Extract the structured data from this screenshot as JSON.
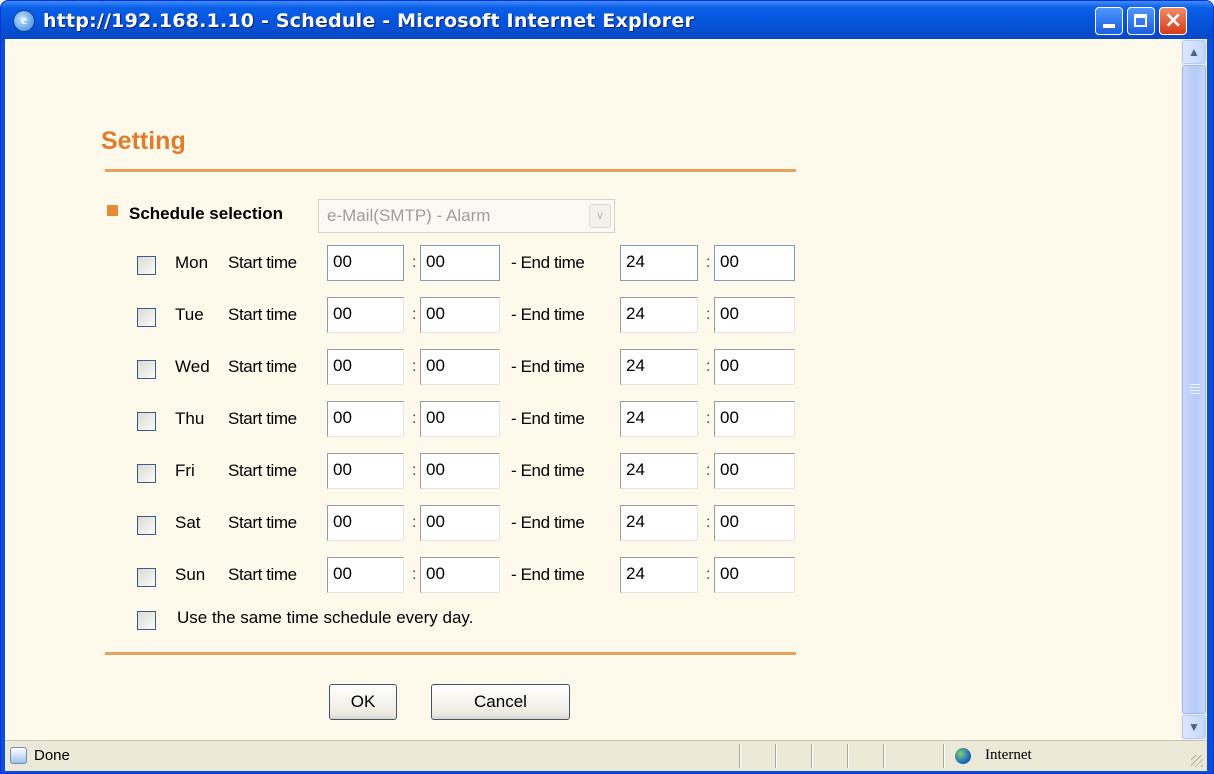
{
  "window": {
    "title": "http://192.168.1.10 - Schedule - Microsoft Internet Explorer"
  },
  "page": {
    "heading": "Setting",
    "schedule_selection_label": "Schedule selection",
    "schedule_selection_value": "e-Mail(SMTP) - Alarm",
    "start_label": "Start time",
    "end_label": "- End time",
    "colon": ":",
    "days": [
      {
        "day": "Mon",
        "start_h": "00",
        "start_m": "00",
        "end_h": "24",
        "end_m": "00"
      },
      {
        "day": "Tue",
        "start_h": "00",
        "start_m": "00",
        "end_h": "24",
        "end_m": "00"
      },
      {
        "day": "Wed",
        "start_h": "00",
        "start_m": "00",
        "end_h": "24",
        "end_m": "00"
      },
      {
        "day": "Thu",
        "start_h": "00",
        "start_m": "00",
        "end_h": "24",
        "end_m": "00"
      },
      {
        "day": "Fri",
        "start_h": "00",
        "start_m": "00",
        "end_h": "24",
        "end_m": "00"
      },
      {
        "day": "Sat",
        "start_h": "00",
        "start_m": "00",
        "end_h": "24",
        "end_m": "00"
      },
      {
        "day": "Sun",
        "start_h": "00",
        "start_m": "00",
        "end_h": "24",
        "end_m": "00"
      }
    ],
    "same_schedule_label": "Use the same time schedule every day.",
    "ok_label": "OK",
    "cancel_label": "Cancel"
  },
  "statusbar": {
    "status_text": "Done",
    "zone_text": "Internet"
  },
  "colors": {
    "heading": "#e07c2c",
    "rule": "#e6a25f",
    "background": "#fefaeb",
    "titlebar": "#0553d9"
  }
}
